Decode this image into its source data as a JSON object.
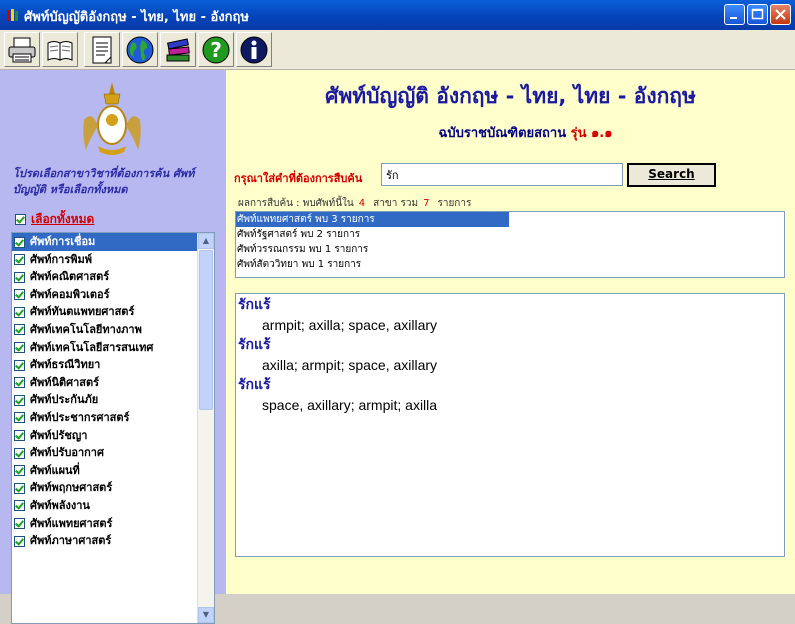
{
  "window": {
    "title": "ศัพท์บัญญัติอังกฤษ - ไทย, ไทย - อังกฤษ"
  },
  "toolbar": {
    "buttons": [
      {
        "icon": "printer-icon"
      },
      {
        "icon": "book-icon"
      },
      {
        "icon": "document-icon"
      },
      {
        "icon": "globe-icon"
      },
      {
        "icon": "books-stack-icon"
      },
      {
        "icon": "help-icon"
      },
      {
        "icon": "info-icon"
      }
    ]
  },
  "sidebar": {
    "hint": "โปรดเลือกสาขาวิชาที่ต้องการค้น ศัพท์บัญญัติ หรือเลือกทั้งหมด",
    "select_all": "เลือกทั้งหมด",
    "categories": [
      "ศัพท์การเชื่อม",
      "ศัพท์การพิมพ์",
      "ศัพท์คณิตศาสตร์",
      "ศัพท์คอมพิวเตอร์",
      "ศัพท์ทันตแพทยศาสตร์",
      "ศัพท์เทคโนโลยีทางภาพ",
      "ศัพท์เทคโนโลยีสารสนเทศ",
      "ศัพท์ธรณีวิทยา",
      "ศัพท์นิติศาสตร์",
      "ศัพท์ประกันภัย",
      "ศัพท์ประชากรศาสตร์",
      "ศัพท์ปรัชญา",
      "ศัพท์ปรับอากาศ",
      "ศัพท์แผนที่",
      "ศัพท์พฤกษศาสตร์",
      "ศัพท์พลังงาน",
      "ศัพท์แพทยศาสตร์",
      "ศัพท์ภาษาศาสตร์"
    ]
  },
  "main": {
    "heading": "ศัพท์บัญญัติ อังกฤษ - ไทย, ไทย - อังกฤษ",
    "edition": "ฉบับราชบัณฑิตยสถาน",
    "version": "รุ่น ๑.๑",
    "search_prompt": "กรุณาใส่คำที่ต้องการสืบค้น",
    "search_value": "รัก",
    "search_button": "Search",
    "result_prefix": "ผลการสืบค้น : พบศัพท์นี้ใน",
    "result_fields": "4",
    "result_mid": "สาขา  รวม",
    "result_total": "7",
    "result_suffix": "รายการ",
    "matches": [
      "ศัพท์แพทยศาสตร์ พบ 3 รายการ",
      "ศัพท์รัฐศาสตร์ พบ 2 รายการ",
      "ศัพท์วรรณกรรม พบ 1 รายการ",
      "ศัพท์สัตววิทยา พบ 1 รายการ"
    ],
    "entries": [
      {
        "term": "รักแร้",
        "meaning": "armpit; axilla; space, axillary"
      },
      {
        "term": "รักแร้",
        "meaning": "axilla; armpit; space, axillary"
      },
      {
        "term": "รักแร้",
        "meaning": "space, axillary; armpit; axilla"
      }
    ]
  }
}
